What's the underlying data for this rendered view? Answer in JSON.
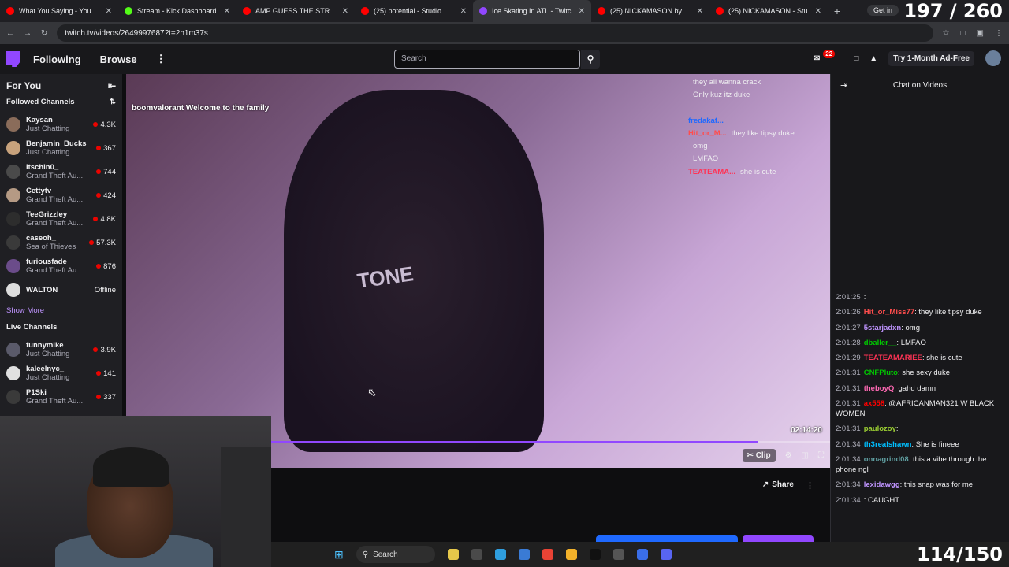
{
  "browser": {
    "tabs": [
      {
        "label": "What You Saying - YouTube",
        "color": "#ff0000"
      },
      {
        "label": "Stream - Kick Dashboard",
        "color": "#53fc18"
      },
      {
        "label": "AMP GUESS THE STRIPPER -",
        "color": "#ff0000"
      },
      {
        "label": "(25) potential - Studio",
        "color": "#ff0000"
      },
      {
        "label": "Ice Skating In ATL - Twitc",
        "color": "#9147ff"
      },
      {
        "label": "(25) NICKAMASON by VNick",
        "color": "#ff0000"
      },
      {
        "label": "(25) NICKAMASON - Stu",
        "color": "#ff0000"
      }
    ],
    "get_in": "Get in",
    "url": "twitch.tv/videos/2649997687?t=2h1m37s"
  },
  "counters": {
    "top": "197 / 260",
    "bottom": "114/150"
  },
  "twitch_nav": {
    "following": "Following",
    "browse": "Browse",
    "search_placeholder": "Search",
    "notif_count": "22",
    "try_adfree": "Try 1-Month Ad-Free"
  },
  "sidebar": {
    "for_you": "For You",
    "followed_channels": "Followed Channels",
    "followed": [
      {
        "name": "Kaysan",
        "game": "Just Chatting",
        "viewers": "4.3K",
        "color": "#8a6c5a"
      },
      {
        "name": "Benjamin_Bucks",
        "game": "Just Chatting",
        "viewers": "367",
        "color": "#c7a27c"
      },
      {
        "name": "itschin0_",
        "game": "Grand Theft Au...",
        "viewers": "744",
        "color": "#4a4a4a"
      },
      {
        "name": "Cettytv",
        "game": "Grand Theft Au...",
        "viewers": "424",
        "color": "#b59a84"
      },
      {
        "name": "TeeGrizzley",
        "game": "Grand Theft Au...",
        "viewers": "4.8K",
        "color": "#2d2d2d"
      },
      {
        "name": "caseoh_",
        "game": "Sea of Thieves",
        "viewers": "57.3K",
        "color": "#3a3a3a"
      },
      {
        "name": "furiousfade",
        "game": "Grand Theft Au...",
        "viewers": "876",
        "color": "#6b4c8a"
      }
    ],
    "offline_channel": {
      "name": "WALTON",
      "status": "Offline"
    },
    "show_more": "Show More",
    "live_channels": "Live Channels",
    "live": [
      {
        "name": "funnymike",
        "game": "Just Chatting",
        "viewers": "3.9K",
        "color": "#5a5a6a"
      },
      {
        "name": "kaleelnyc_",
        "game": "Just Chatting",
        "viewers": "141",
        "color": "#e0e0e0"
      },
      {
        "name": "P1Ski",
        "game": "Grand Theft Au...",
        "viewers": "337",
        "color": "#3a3a3a"
      }
    ]
  },
  "video": {
    "overlay_message": "boomvalorant Welcome to the family",
    "shirt_text": "TONE",
    "overlay_chat": [
      {
        "user": "",
        "msg": "they all wanna crack",
        "ucolor": "#bf94ff"
      },
      {
        "user": "",
        "msg": "Only kuz itz duke",
        "ucolor": "#bf94ff"
      },
      {
        "user": "",
        "msg": "",
        "ucolor": "#bf94ff"
      },
      {
        "user": "fredakaf...",
        "msg": "",
        "ucolor": "#1f69ff"
      },
      {
        "user": "Hit_or_M...",
        "msg": "they like tipsy duke",
        "ucolor": "#ff4d4d"
      },
      {
        "user": "",
        "msg": "omg",
        "ucolor": "#bf94ff"
      },
      {
        "user": "",
        "msg": "LMFAO",
        "ucolor": "#00c800"
      },
      {
        "user": "TEATEAMA...",
        "msg": "she is cute",
        "ucolor": "#ff3355"
      }
    ],
    "timestamp": "02:14:20",
    "progress": 0.87,
    "clip_label": "Clip",
    "share_label": "Share"
  },
  "chat": {
    "title": "Chat on Videos",
    "messages": [
      {
        "time": "2:01:25",
        "user": "",
        "text": "",
        "ucolor": "#1f69ff"
      },
      {
        "time": "2:01:26",
        "user": "Hit_or_Miss77",
        "text": "they like tipsy duke",
        "ucolor": "#ff4d4d"
      },
      {
        "time": "2:01:27",
        "user": "5starjadxn",
        "text": "omg",
        "ucolor": "#bf94ff"
      },
      {
        "time": "2:01:28",
        "user": "dballer__",
        "text": "LMFAO",
        "ucolor": "#00c800"
      },
      {
        "time": "2:01:29",
        "user": "TEATEAMARIEE",
        "text": "she is cute",
        "ucolor": "#ff3355"
      },
      {
        "time": "2:01:31",
        "user": "CNFPluto",
        "text": "she sexy duke",
        "ucolor": "#00c800"
      },
      {
        "time": "2:01:31",
        "user": "theboyQ",
        "text": "gahd damn",
        "ucolor": "#ff69b4"
      },
      {
        "time": "2:01:31",
        "user": "ax558",
        "text": "@AFRICANMAN321 W BLACK WOMEN",
        "ucolor": "#ff0000"
      },
      {
        "time": "2:01:31",
        "user": "paulozoy",
        "text": "",
        "ucolor": "#9acd32"
      },
      {
        "time": "2:01:34",
        "user": "th3realshawn",
        "text": "She is fineee",
        "ucolor": "#00bfff"
      },
      {
        "time": "2:01:34",
        "user": "onnagrind08",
        "text": "this a vibe through the phone ngl",
        "ucolor": "#5f9ea0"
      },
      {
        "time": "2:01:34",
        "user": "lexidawgg",
        "text": "this snap was for me",
        "ucolor": "#bf94ff"
      },
      {
        "time": "2:01:34",
        "user": "",
        "text": "CAUGHT",
        "ucolor": "#1f69ff"
      }
    ]
  },
  "taskbar": {
    "search": "Search"
  }
}
